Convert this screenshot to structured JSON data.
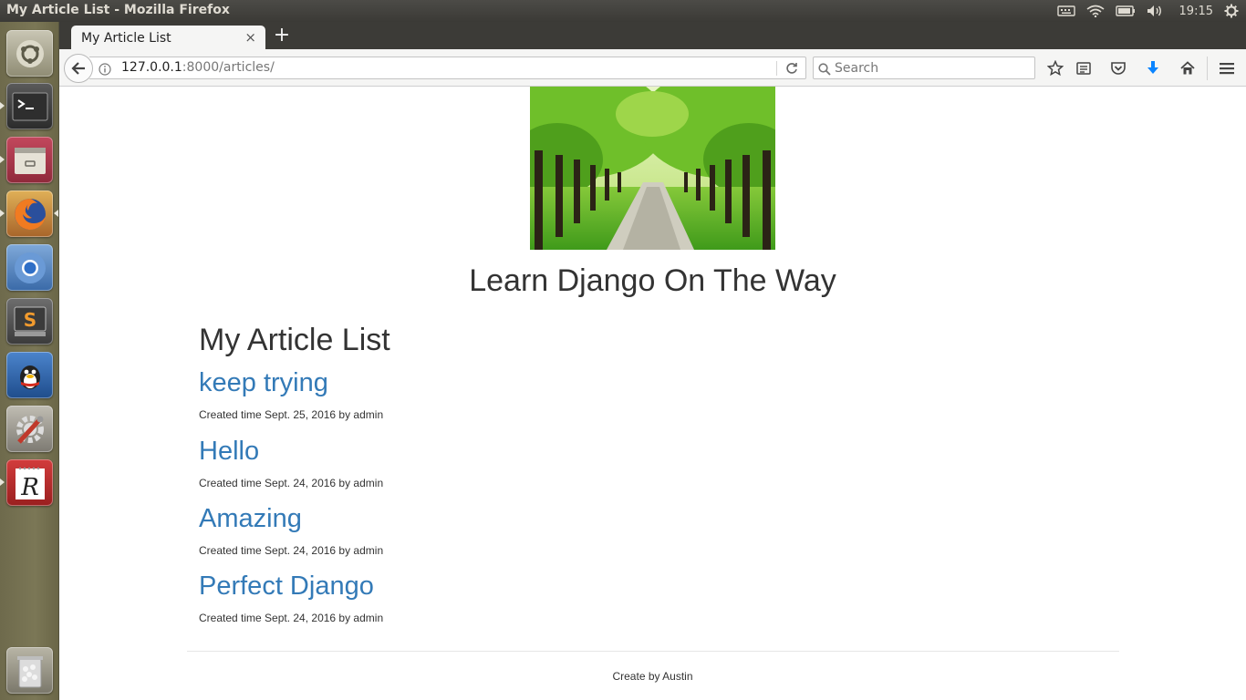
{
  "window": {
    "title": "My Article List - Mozilla Firefox"
  },
  "panel": {
    "clock": "19:15"
  },
  "launcher": {
    "items": [
      {
        "name": "ubuntu-dash-icon"
      },
      {
        "name": "terminal-icon"
      },
      {
        "name": "files-icon"
      },
      {
        "name": "firefox-icon"
      },
      {
        "name": "chromium-icon"
      },
      {
        "name": "sublime-text-icon"
      },
      {
        "name": "qq-icon"
      },
      {
        "name": "system-settings-icon"
      },
      {
        "name": "rstudio-icon"
      },
      {
        "name": "trash-icon"
      }
    ]
  },
  "browser": {
    "tab": {
      "title": "My Article List",
      "close": "×"
    },
    "new_tab": "+",
    "url": {
      "host": "127.0.0.1",
      "rest": ":8000/articles/"
    },
    "search": {
      "placeholder": "Search"
    }
  },
  "page": {
    "site_title": "Learn Django On The Way",
    "heading": "My Article List",
    "articles": [
      {
        "title": "keep trying",
        "meta": "Created time Sept. 25, 2016 by admin"
      },
      {
        "title": "Hello",
        "meta": "Created time Sept. 24, 2016 by admin"
      },
      {
        "title": "Amazing",
        "meta": "Created time Sept. 24, 2016 by admin"
      },
      {
        "title": "Perfect Django",
        "meta": "Created time Sept. 24, 2016 by admin"
      }
    ],
    "footer": "Create by Austin"
  },
  "colors": {
    "link": "#337ab7",
    "text": "#333333",
    "firefox_download_accent": "#0a84ff"
  }
}
